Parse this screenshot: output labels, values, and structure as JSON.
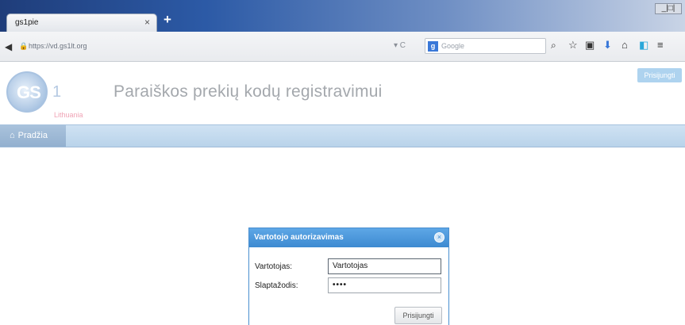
{
  "browser": {
    "tab_title": "gs1pie",
    "tab_close": "×",
    "new_tab": "+",
    "window_controls": "_|□|",
    "url": "https://vd.gs1lt.org",
    "search_placeholder": "Google",
    "search_engine_letter": "g"
  },
  "header": {
    "logo_text": "GS",
    "logo_one": "1",
    "logo_sub": "Lithuania",
    "title": "Paraiškos prekių kodų registravimui",
    "login_button": "Prisijungti"
  },
  "menu": {
    "home_label": "Pradžia"
  },
  "dialog": {
    "title": "Vartotojo autorizavimas",
    "username_label": "Vartotojas:",
    "username_value": "Vartotojas",
    "password_label": "Slaptažodis:",
    "password_value": "••••",
    "submit_label": "Prisijungti"
  },
  "colors": {
    "dialog_header": "#3d8ad1",
    "menu_bar": "#b9d3ea",
    "title_text": "#a4a8ad"
  }
}
